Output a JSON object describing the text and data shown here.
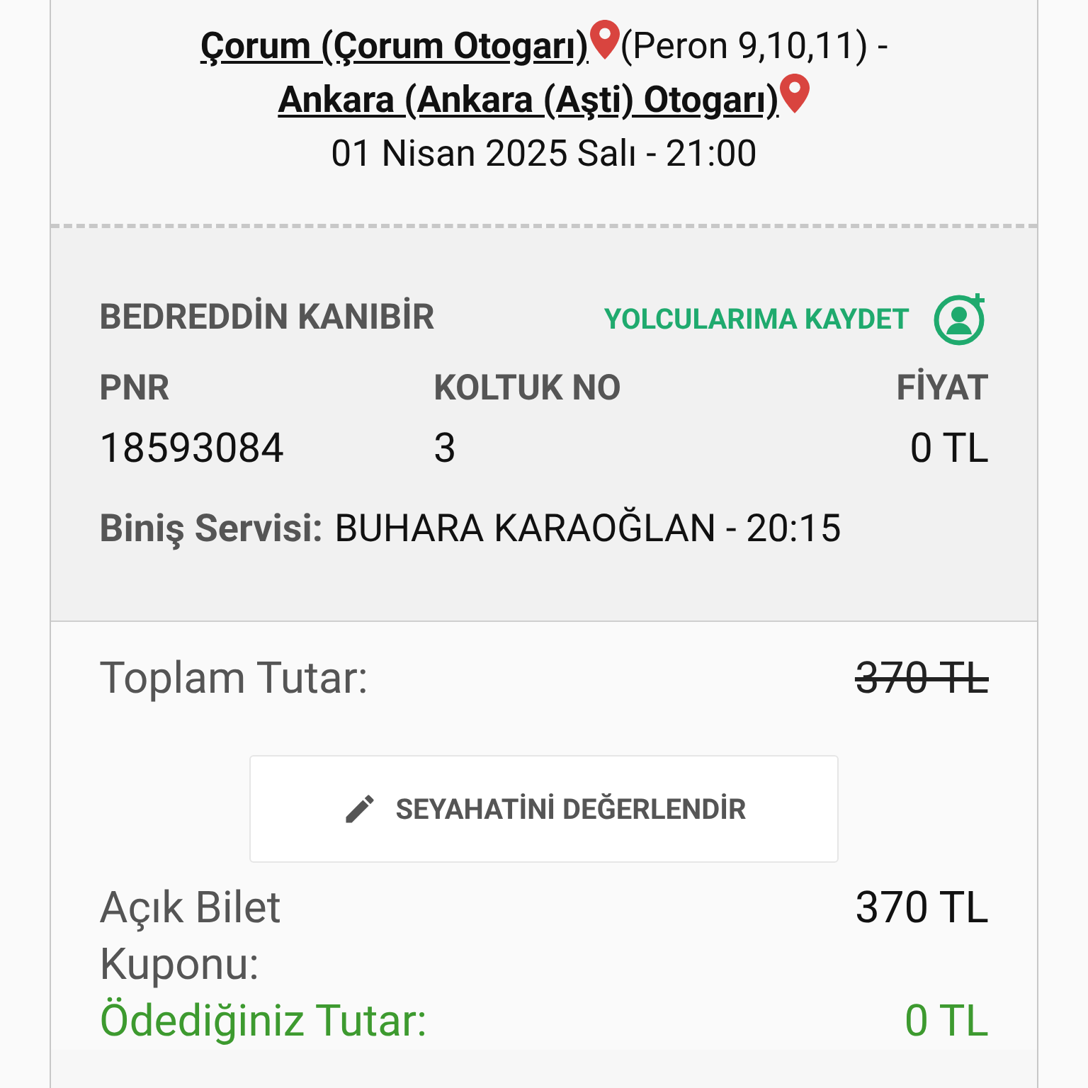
{
  "route": {
    "origin": {
      "name": "Çorum (Çorum Otogarı)",
      "note": "(Peron 9,10,11) -"
    },
    "destination": {
      "name": "Ankara (Ankara (Aşti) Otogarı)"
    },
    "datetime": "01 Nisan 2025 Salı - 21:00"
  },
  "passenger": {
    "name": "BEDREDDİN KANIBİR",
    "save_label": "YOLCULARIMA KAYDET",
    "fields": [
      {
        "label": "PNR",
        "value": "18593084"
      },
      {
        "label": "KOLTUK NO",
        "value": "3"
      },
      {
        "label": "FİYAT",
        "value": "0 TL"
      }
    ],
    "boarding": {
      "label": "Biniş Servisi:",
      "value": "BUHARA KARAOĞLAN - 20:15"
    }
  },
  "totals": [
    {
      "kind": "total",
      "label": "Toplam Tutar:",
      "value": "370 TL",
      "struck": true
    }
  ],
  "rate_button": "SEYAHATİNİ DEĞERLENDİR",
  "summary": [
    {
      "kind": "coupon",
      "label": "Açık Bilet Kuponu:",
      "value": "370 TL",
      "struck": false
    },
    {
      "kind": "paid",
      "label": "Ödediğiniz Tutar:",
      "value": "0 TL",
      "struck": false
    }
  ]
}
